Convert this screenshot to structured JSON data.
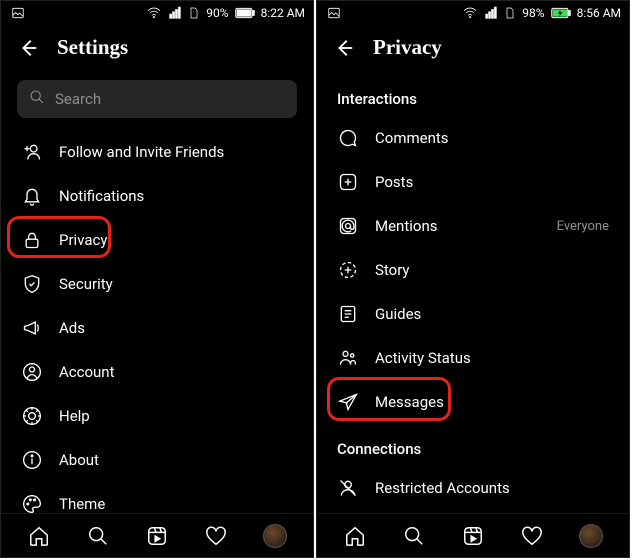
{
  "left": {
    "status": {
      "battery_pct": "90%",
      "time": "8:22 AM",
      "charging": false
    },
    "header": {
      "title": "Settings"
    },
    "search": {
      "placeholder": "Search"
    },
    "items": [
      {
        "label": "Follow and Invite Friends",
        "icon": "add-user-icon"
      },
      {
        "label": "Notifications",
        "icon": "bell-icon"
      },
      {
        "label": "Privacy",
        "icon": "lock-icon",
        "highlight": true
      },
      {
        "label": "Security",
        "icon": "shield-icon"
      },
      {
        "label": "Ads",
        "icon": "megaphone-icon"
      },
      {
        "label": "Account",
        "icon": "account-icon"
      },
      {
        "label": "Help",
        "icon": "help-icon"
      },
      {
        "label": "About",
        "icon": "info-icon"
      },
      {
        "label": "Theme",
        "icon": "palette-icon"
      }
    ]
  },
  "right": {
    "status": {
      "battery_pct": "98%",
      "time": "8:56 AM",
      "charging": true
    },
    "header": {
      "title": "Privacy"
    },
    "section1": "Interactions",
    "items": [
      {
        "label": "Comments",
        "icon": "comment-icon"
      },
      {
        "label": "Posts",
        "icon": "post-icon"
      },
      {
        "label": "Mentions",
        "icon": "mention-icon",
        "value": "Everyone"
      },
      {
        "label": "Story",
        "icon": "story-icon"
      },
      {
        "label": "Guides",
        "icon": "guides-icon"
      },
      {
        "label": "Activity Status",
        "icon": "activity-icon"
      },
      {
        "label": "Messages",
        "icon": "messages-icon",
        "highlight": true
      }
    ],
    "section2": "Connections",
    "items2": [
      {
        "label": "Restricted Accounts",
        "icon": "restricted-icon"
      }
    ]
  },
  "highlight_color": "#e1251b"
}
